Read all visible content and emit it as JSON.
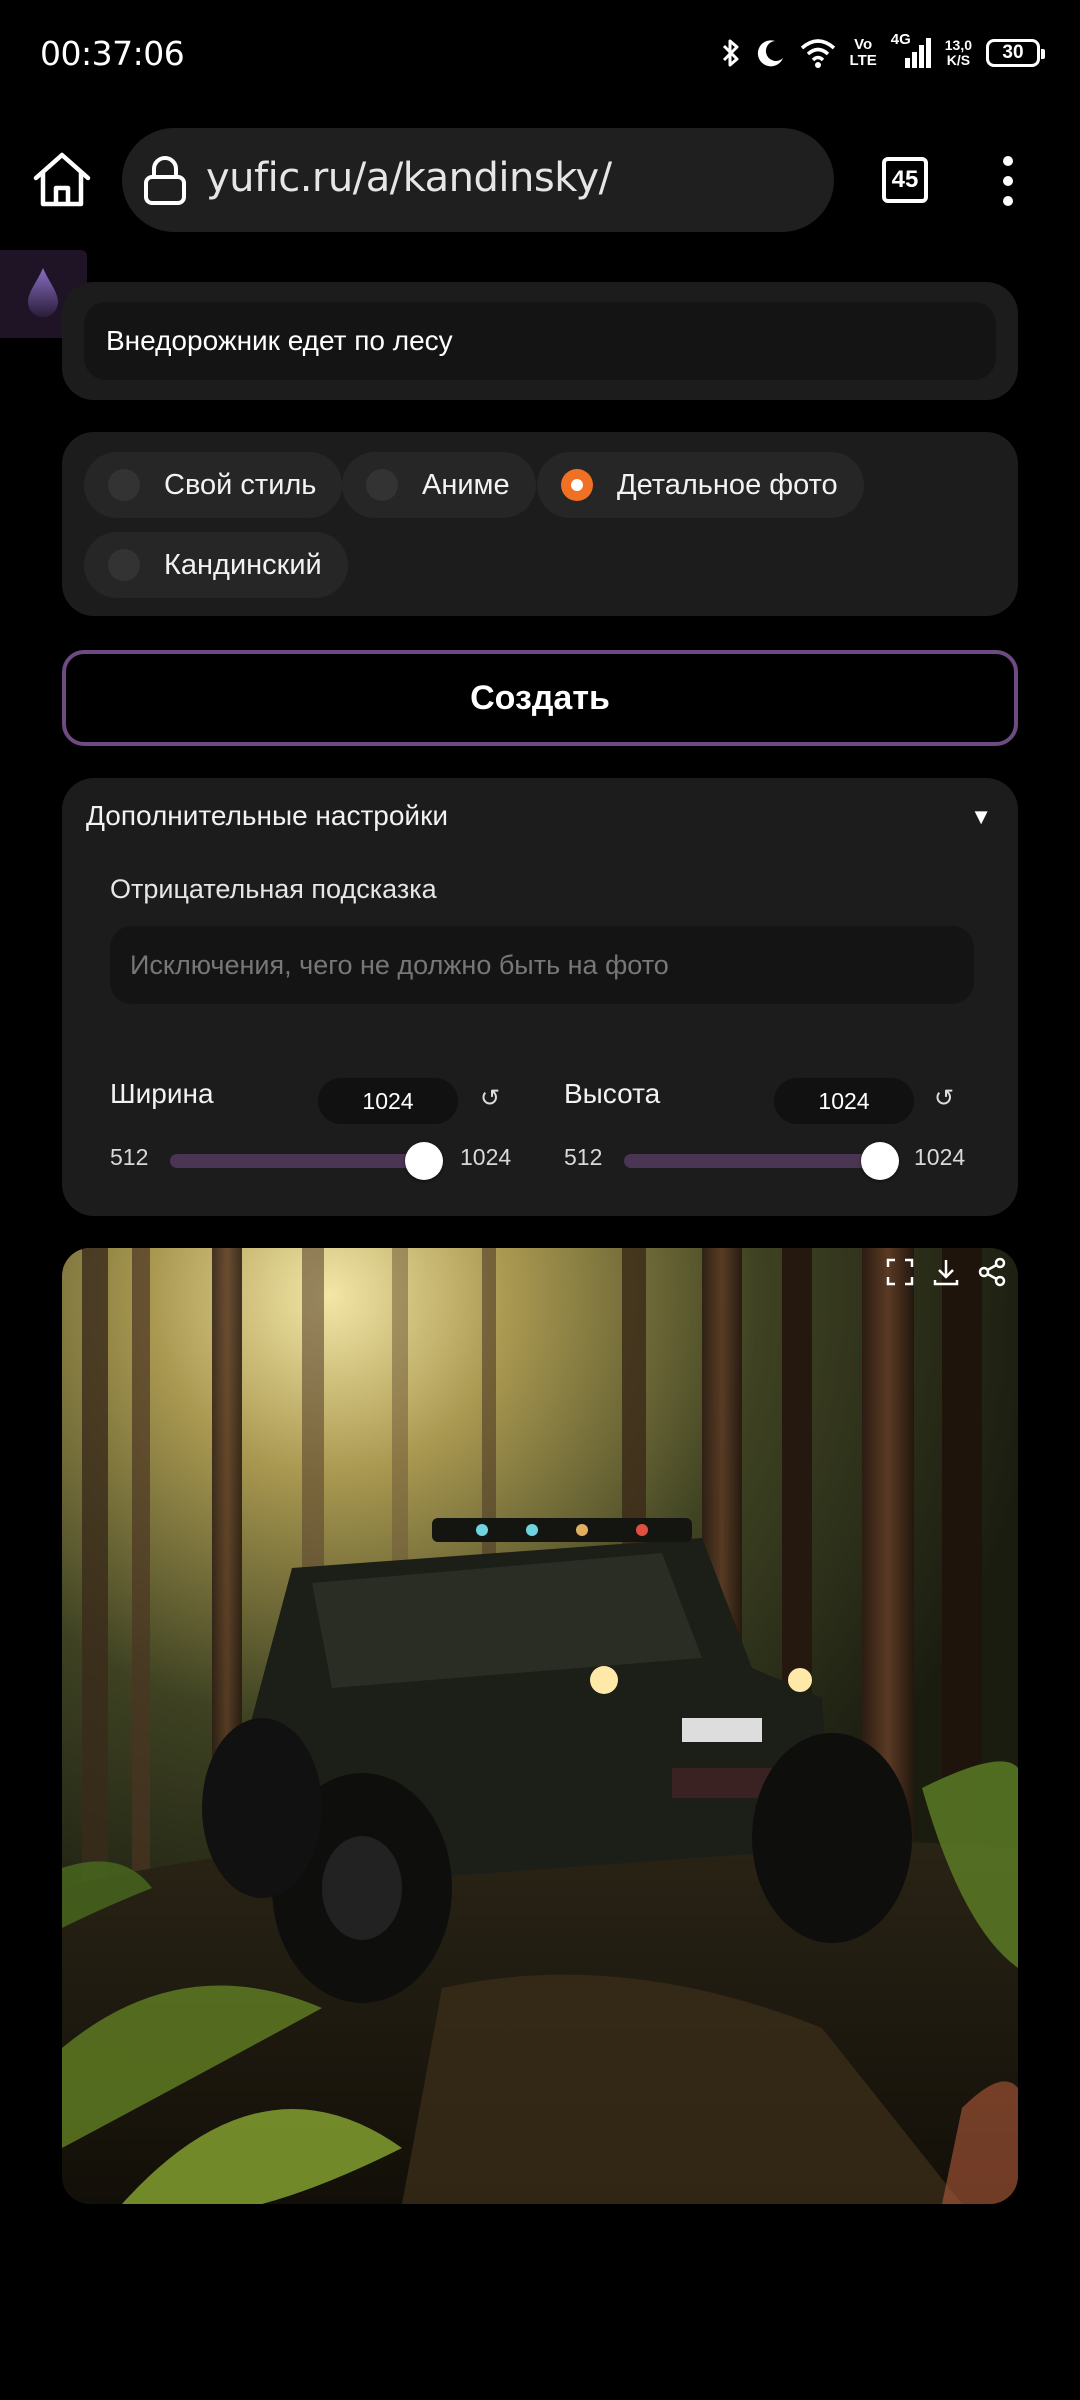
{
  "status_bar": {
    "time": "00:37:06",
    "network_top": "Vo",
    "network_bottom": "LTE",
    "network_type": "4G",
    "speed_value": "13,0",
    "speed_unit": "K/S",
    "battery": "30"
  },
  "browser": {
    "url": "yufic.ru/a/kandinsky/",
    "tab_count": "45"
  },
  "prompt": {
    "value": "Внедорожник едет по лесу"
  },
  "styles": {
    "options": [
      {
        "label": "Свой стиль",
        "selected": false
      },
      {
        "label": "Аниме",
        "selected": false
      },
      {
        "label": "Детальное фото",
        "selected": true
      },
      {
        "label": "Кандинский",
        "selected": false
      }
    ]
  },
  "create_button": {
    "label": "Создать"
  },
  "settings": {
    "title": "Дополнительные настройки",
    "toggle_symbol": "▼",
    "negative_label": "Отрицательная подсказка",
    "negative_placeholder": "Исключения, чего не должно быть на фото",
    "width": {
      "label": "Ширина",
      "value": "1024",
      "min": "512",
      "max": "1024",
      "fraction": 1.0
    },
    "height": {
      "label": "Высота",
      "value": "1024",
      "min": "512",
      "max": "1024",
      "fraction": 1.0
    },
    "reset_symbol": "↺"
  },
  "image_actions": [
    "fullscreen-icon",
    "download-icon",
    "share-icon"
  ],
  "colors": {
    "accent_orange": "#f07123",
    "create_border": "#6e4a82",
    "slider_track": "#4a3553",
    "panel_bg": "#1c1c1c"
  }
}
